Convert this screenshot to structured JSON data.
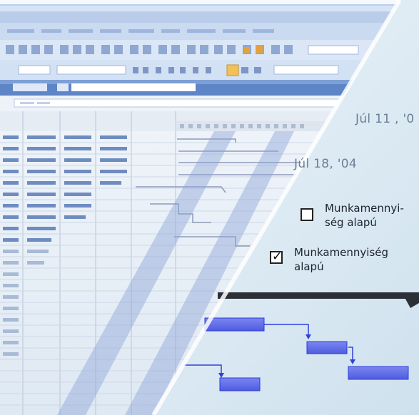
{
  "timeline": {
    "dates": [
      "Júl 11 , '0",
      "Júl 18, '04"
    ]
  },
  "options": [
    {
      "line1": "Munkamennyi-",
      "line2": "ség alapú",
      "checked": false
    },
    {
      "line1": "Munkamennyiség",
      "line2": "alapú",
      "checked": true
    }
  ],
  "icons": [
    "checkbox-empty-icon",
    "checkmark-icon"
  ],
  "colors": {
    "bar_fill": "#5c6ae8",
    "bar_stroke": "#2b3bd6",
    "link_line": "#2f3fe0",
    "toolbar_blue": "#c9d9f2",
    "sky_gradient_top": "#eef5fa",
    "sky_gradient_bottom": "#d3e5f0"
  }
}
